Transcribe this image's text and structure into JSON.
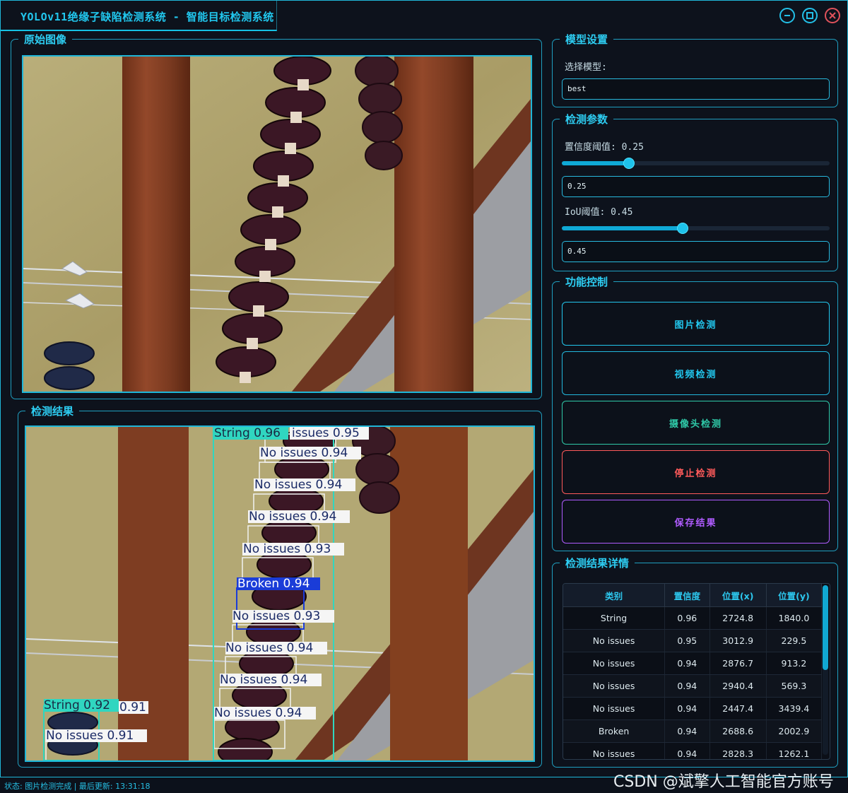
{
  "window": {
    "title": "YOLOv11绝缘子缺陷检测系统 - 智能目标检测系统"
  },
  "panels": {
    "original": "原始图像",
    "result": "检测结果"
  },
  "model": {
    "group_title": "模型设置",
    "select_label": "选择模型:",
    "selected": "best"
  },
  "params": {
    "group_title": "检测参数",
    "conf_label": "置信度阈值: 0.25",
    "conf_value": "0.25",
    "conf_fraction": 0.25,
    "iou_label": "IoU阈值: 0.45",
    "iou_value": "0.45",
    "iou_fraction": 0.45
  },
  "controls": {
    "group_title": "功能控制",
    "image_detect": "图片检测",
    "video_detect": "视频检测",
    "camera_detect": "摄像头检测",
    "stop_detect": "停止检测",
    "save_results": "保存结果",
    "colors": {
      "cyan": "#22c7ee",
      "teal": "#2fc9a8",
      "red": "#ff5a5a",
      "purple": "#b05cff"
    }
  },
  "results": {
    "group_title": "检测结果详情",
    "columns": [
      "类别",
      "置信度",
      "位置(x)",
      "位置(y)"
    ],
    "rows": [
      [
        "String",
        "0.96",
        "2724.8",
        "1840.0"
      ],
      [
        "No issues",
        "0.95",
        "3012.9",
        "229.5"
      ],
      [
        "No issues",
        "0.94",
        "2876.7",
        "913.2"
      ],
      [
        "No issues",
        "0.94",
        "2940.4",
        "569.3"
      ],
      [
        "No issues",
        "0.94",
        "2447.4",
        "3439.4"
      ],
      [
        "Broken",
        "0.94",
        "2688.6",
        "2002.9"
      ],
      [
        "No issues",
        "0.94",
        "2828.3",
        "1262.1"
      ]
    ]
  },
  "detections": {
    "labels": [
      "String 0.96",
      "issues 0.95",
      "No issues 0.94",
      "No issues 0.94",
      "No issues 0.94",
      "No issues 0.93",
      "Broken 0.94",
      "No issues 0.93",
      "No issues 0.94",
      "No issues 0.94",
      "No issues 0.94",
      "String 0.92",
      "0.91",
      "No issues 0.91"
    ]
  },
  "status": {
    "text": "状态: 图片检测完成 | 最后更新: 13:31:18"
  },
  "watermark": "CSDN @斌擎人工智能官方账号",
  "icons": {
    "minimize": "minimize-icon",
    "maximize": "maximize-icon",
    "close": "close-icon"
  }
}
